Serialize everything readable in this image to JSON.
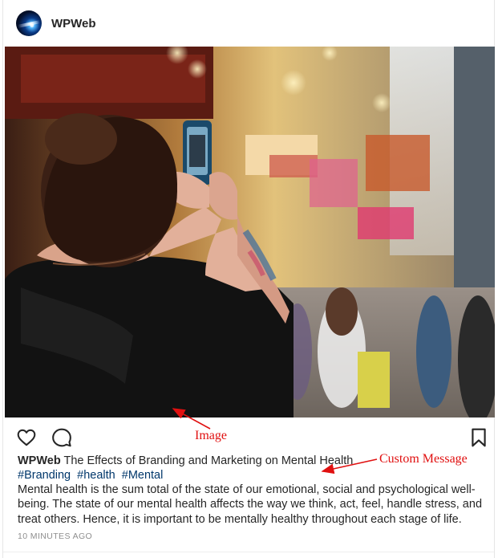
{
  "post": {
    "username": "WPWeb",
    "title": "The Effects of Branding and Marketing on Mental Health",
    "hashtags": [
      "#Branding",
      "#health",
      "#Mental"
    ],
    "message": "Mental health is the sum total of the state of our emotional, social and psychological well-being. The state of our mental health affects the way we think, act, feel, handle stress, and treat others. Hence, it is important to be mentally healthy throughout each stage of life.",
    "timestamp": "10 MINUTES AGO"
  },
  "actions": {
    "like_icon": "heart-icon",
    "comment_icon": "comment-icon",
    "save_icon": "bookmark-icon"
  },
  "annotations": {
    "image_label": "Image",
    "custom_message_label": "Custom Message",
    "color": "#e01010"
  }
}
